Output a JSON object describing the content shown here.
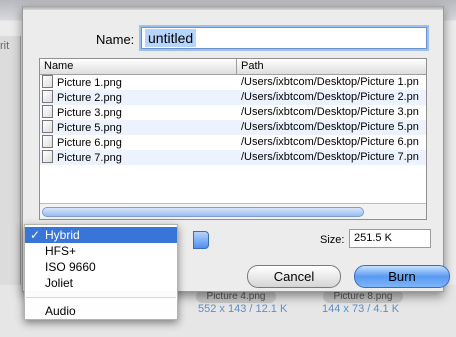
{
  "dialog": {
    "name_label": "Name:",
    "name_value": "untitled",
    "columns": [
      "Name",
      "Path"
    ],
    "files": [
      {
        "name": "Picture 1.png",
        "path": "/Users/ixbtcom/Desktop/Picture 1.pn"
      },
      {
        "name": "Picture 2.png",
        "path": "/Users/ixbtcom/Desktop/Picture 2.pn"
      },
      {
        "name": "Picture 3.png",
        "path": "/Users/ixbtcom/Desktop/Picture 3.pn"
      },
      {
        "name": "Picture 5.png",
        "path": "/Users/ixbtcom/Desktop/Picture 5.pn"
      },
      {
        "name": "Picture 6.png",
        "path": "/Users/ixbtcom/Desktop/Picture 6.pn"
      },
      {
        "name": "Picture 7.png",
        "path": "/Users/ixbtcom/Desktop/Picture 7.pn"
      }
    ],
    "size_label": "Size:",
    "size_value": "251.5 K",
    "cancel_label": "Cancel",
    "burn_label": "Burn"
  },
  "format_menu": {
    "options": [
      "Hybrid",
      "HFS+",
      "ISO 9660",
      "Joliet",
      "Audio"
    ],
    "selected": "Hybrid",
    "check_glyph": "✓"
  },
  "background": {
    "left_text": "rit",
    "caption_1": "552 x 143 / 12.1 K",
    "caption_2": "144 x 73 / 4.1 K",
    "pill_1": "Picture 4.png",
    "pill_2": "Picture 8.png"
  },
  "colors": {
    "selection": "#3875d7",
    "default_button": "#5a9af2",
    "focus_ring": "#9cc1ef"
  }
}
